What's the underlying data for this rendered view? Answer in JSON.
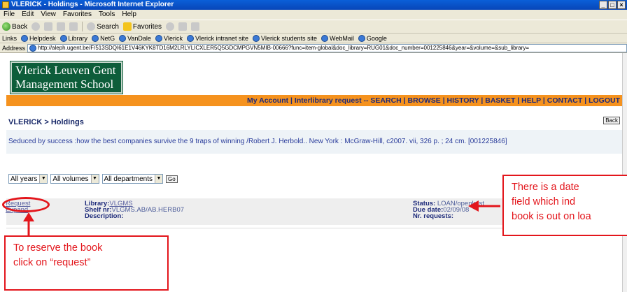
{
  "window": {
    "title": "VLERICK - Holdings - Microsoft Internet Explorer",
    "min": "_",
    "max": "□",
    "close": "×"
  },
  "menu": [
    "File",
    "Edit",
    "View",
    "Favorites",
    "Tools",
    "Help"
  ],
  "toolbar": {
    "back": "Back",
    "search": "Search",
    "favorites": "Favorites"
  },
  "links": {
    "label": "Links",
    "items": [
      "Helpdesk",
      "Library",
      "NetG",
      "VanDale",
      "Vlerick",
      "Vlerick intranet site",
      "Vlerick students site",
      "WebMail",
      "Google"
    ]
  },
  "address": {
    "label": "Address",
    "url": "http://aleph.ugent.be/F/513SDQI61E1V46KYK8TD16M2LRLYLICXLER5Q5GDCMPGVN5MIB-00666?func=item-global&doc_library=RUG01&doc_number=001225846&year=&volume=&sub_library="
  },
  "page": {
    "logo_line1": "Vlerick Leuven Gent",
    "logo_line2": "Management School",
    "nav": "My Account | Interlibrary request -- SEARCH | BROWSE | HISTORY | BASKET | HELP | CONTACT | LOGOUT",
    "breadcrumb": "VLERICK > Holdings",
    "back_button": "Back",
    "record": "Seduced by success :how the best companies survive the 9 traps of winning /Robert J. Herbold..   New York : McGraw-Hill, c2007.  vii, 326 p. ;  24 cm. [001225846]",
    "filters": {
      "years": "All years",
      "volumes": "All volumes",
      "departments": "All departments",
      "go": "Go"
    },
    "holding": {
      "request": "Request",
      "expand": "Expand",
      "library_label": "Library:",
      "library_value": "VLGMS",
      "shelf_label": "Shelf nr:",
      "shelf_value": "VLGMS.AB/AB.HERB07",
      "description_label": "Description:",
      "status_label": "Status:",
      "status_value": "LOAN/openkast",
      "due_label": "Due date:",
      "due_value": "02/09/08",
      "requests_label": "Nr. requests:"
    }
  },
  "annotations": {
    "reserve_line1": "To reserve the book",
    "reserve_line2": "click on “request”",
    "date_line1": "There is a date",
    "date_line2": "field which ind",
    "date_line3": "book is out on loa",
    "color": "#e3161c"
  }
}
